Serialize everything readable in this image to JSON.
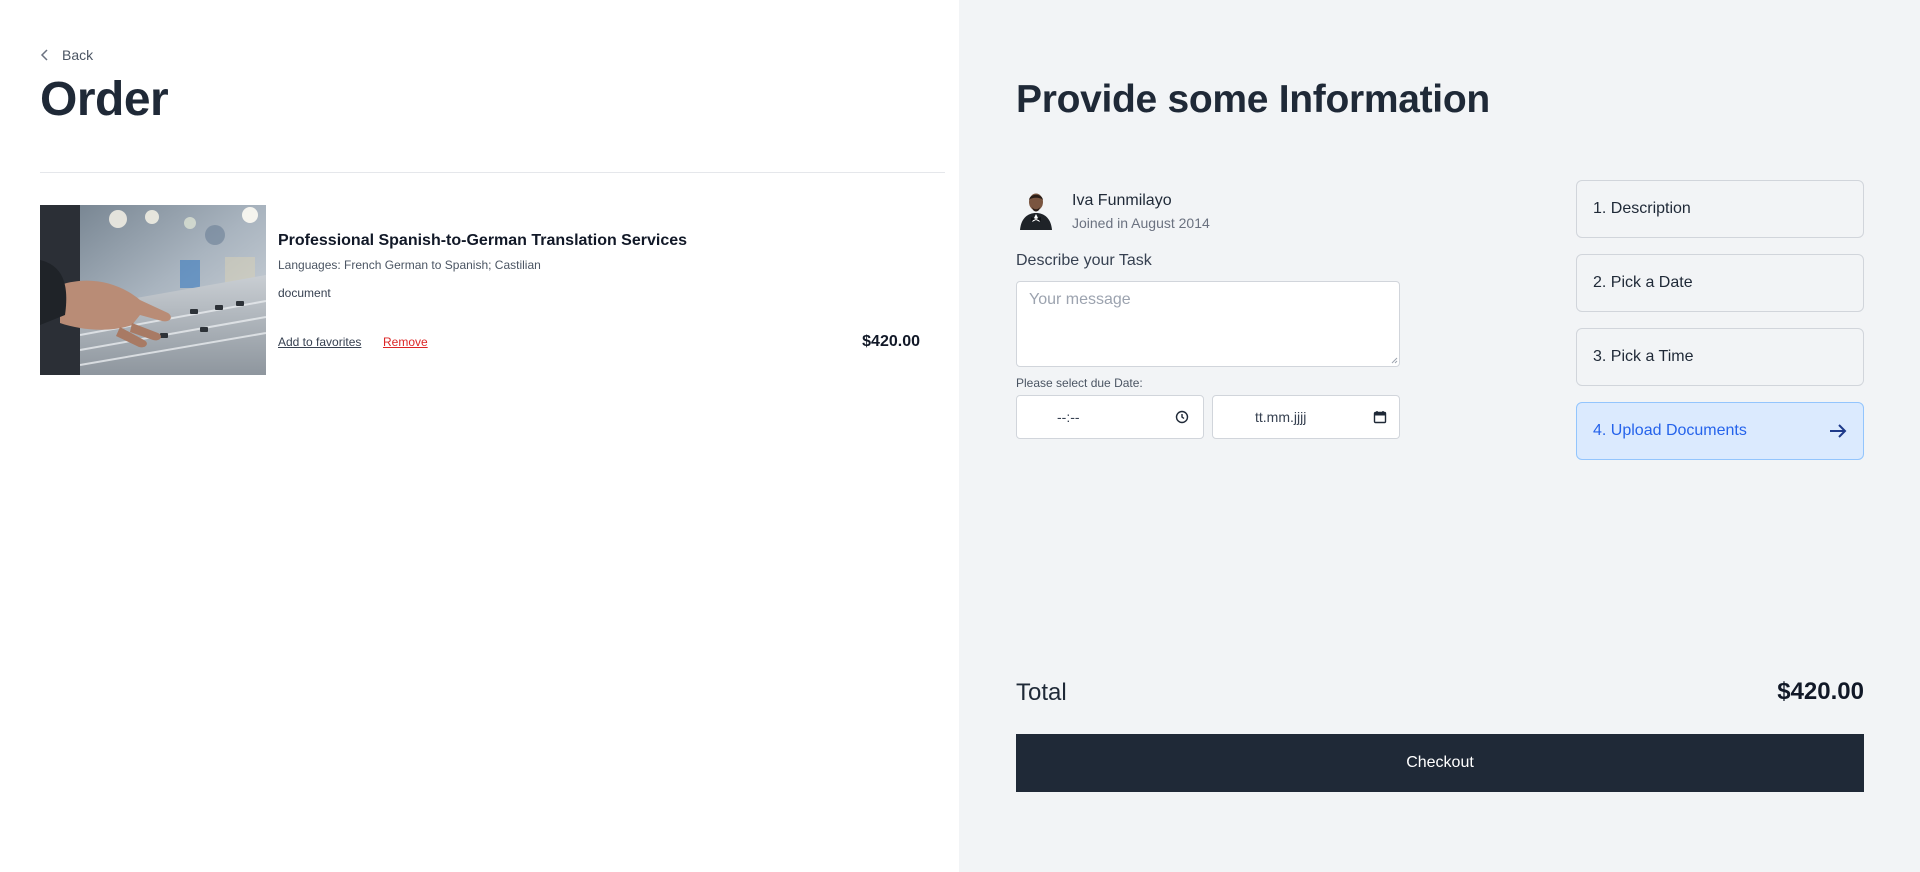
{
  "order": {
    "back_label": "Back",
    "title": "Order",
    "item": {
      "title": "Professional Spanish-to-German Translation Services",
      "languages": "Languages: French German to Spanish; Castilian",
      "type": "document",
      "favorites_label": "Add to favorites",
      "remove_label": "Remove",
      "price": "$420.00"
    }
  },
  "info": {
    "title": "Provide some Information",
    "user": {
      "name": "Iva Funmilayo",
      "joined": "Joined in August 2014"
    },
    "task_label": "Describe your Task",
    "task_placeholder": "Your message",
    "due_label": "Please select due Date:",
    "time_value": "--:--",
    "date_value": "tt.mm.jjjj",
    "steps": [
      {
        "label": "1. Description",
        "active": false
      },
      {
        "label": "2. Pick a Date",
        "active": false
      },
      {
        "label": "3. Pick a Time",
        "active": false
      },
      {
        "label": "4. Upload Documents",
        "active": true
      }
    ],
    "total_label": "Total",
    "total_value": "$420.00",
    "checkout_label": "Checkout"
  },
  "colors": {
    "primary_dark": "#1f2937",
    "panel_bg": "#f2f4f6",
    "active_step_bg": "#dbeafe",
    "active_step_text": "#2563eb",
    "remove_red": "#dc2626"
  },
  "icons": {
    "back": "chevron-left-icon",
    "time": "clock-icon",
    "date": "calendar-icon",
    "step_arrow": "arrow-right-icon"
  }
}
